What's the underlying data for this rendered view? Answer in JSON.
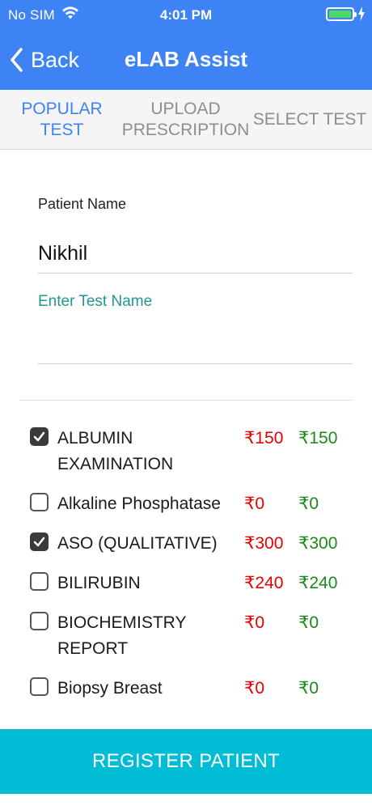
{
  "status_bar": {
    "carrier": "No SIM",
    "time": "4:01 PM"
  },
  "nav": {
    "back_label": "Back",
    "title": "eLAB Assist"
  },
  "tabs": [
    {
      "label_line1": "POPULAR",
      "label_line2": "TEST",
      "active": true
    },
    {
      "label_line1": "UPLOAD",
      "label_line2": "PRESCRIPTION",
      "active": false
    },
    {
      "label_line1": "SELECT TEST",
      "label_line2": "",
      "active": false
    }
  ],
  "form": {
    "patient_label": "Patient Name",
    "patient_value": "Nikhil",
    "test_placeholder": "Enter Test Name",
    "test_value": ""
  },
  "tests": [
    {
      "name": "ALBUMIN EXAMINATION",
      "price_red": "₹150",
      "price_green": "₹150",
      "checked": true
    },
    {
      "name": "Alkaline Phosphatase",
      "price_red": "₹0",
      "price_green": "₹0",
      "checked": false
    },
    {
      "name": "ASO (QUALITATIVE)",
      "price_red": "₹300",
      "price_green": "₹300",
      "checked": true
    },
    {
      "name": "BILIRUBIN",
      "price_red": "₹240",
      "price_green": "₹240",
      "checked": false
    },
    {
      "name": "BIOCHEMISTRY REPORT",
      "price_red": "₹0",
      "price_green": "₹0",
      "checked": false
    },
    {
      "name": "Biopsy Breast",
      "price_red": "₹0",
      "price_green": "₹0",
      "checked": false
    }
  ],
  "footer": {
    "register_label": "REGISTER PATIENT"
  },
  "colors": {
    "primary": "#3d83f3",
    "accent": "#00bcd4",
    "price_red": "#e60000",
    "price_green": "#1a8a1a",
    "placeholder": "#22968f"
  }
}
